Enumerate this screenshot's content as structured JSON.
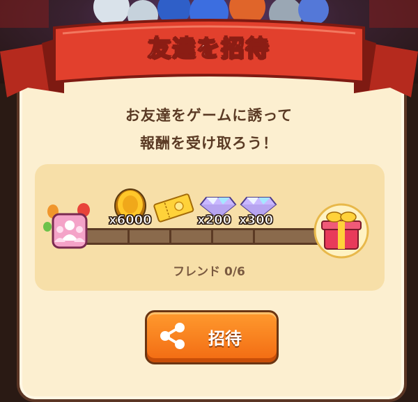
{
  "dialog": {
    "title": "友達を招待",
    "description_line1": "お友達をゲームに誘って",
    "description_line2": "報酬を受け取ろう！"
  },
  "rewards": {
    "items": [
      {
        "icon": "gold-coin-icon",
        "quantity": "x6000"
      },
      {
        "icon": "ticket-icon",
        "quantity": ""
      },
      {
        "icon": "diamond-icon",
        "quantity": "x200"
      },
      {
        "icon": "diamond-icon",
        "quantity": "x300"
      }
    ],
    "start_icon": "friends-group-icon",
    "end_icon": "gift-box-icon",
    "friend_progress": "フレンド 0/6",
    "friends_invited": 0,
    "friends_required": 6
  },
  "invite_button": {
    "label": "招待",
    "icon": "share-icon"
  },
  "colors": {
    "ribbon": "#e2402d",
    "panel": "#fcefd0",
    "button": "#f5801c"
  }
}
